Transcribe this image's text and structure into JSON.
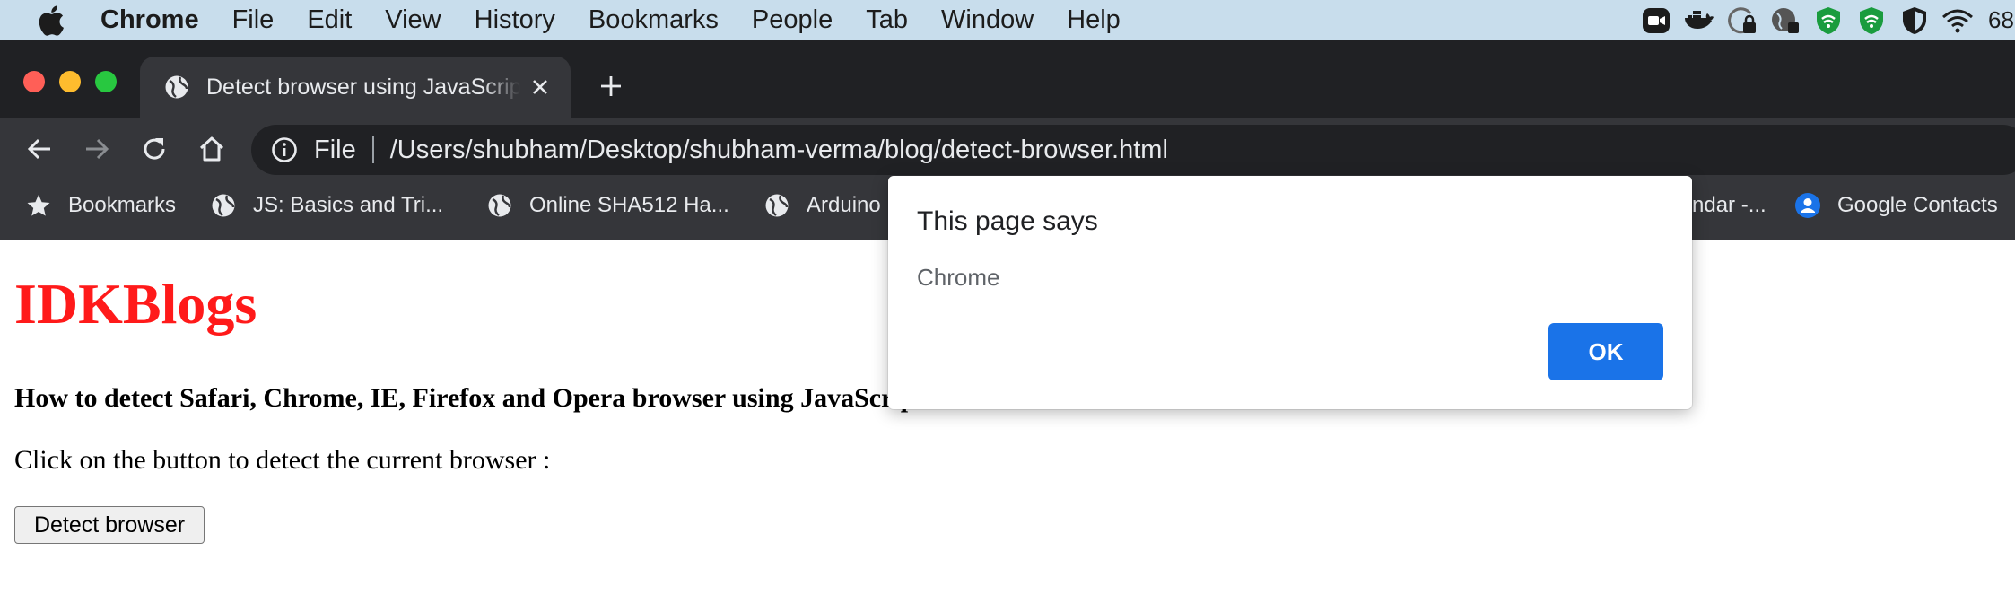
{
  "menubar": {
    "app_name": "Chrome",
    "items": [
      "File",
      "Edit",
      "View",
      "History",
      "Bookmarks",
      "People",
      "Tab",
      "Window",
      "Help"
    ],
    "clock_partial": "68"
  },
  "tab": {
    "title": "Detect browser using JavaScript"
  },
  "omnibox": {
    "scheme_label": "File",
    "url": "/Users/shubham/Desktop/shubham-verma/blog/detect-browser.html"
  },
  "bookmarks": {
    "items": [
      {
        "label": "Bookmarks",
        "icon": "star-icon"
      },
      {
        "label": "JS: Basics and Tri...",
        "icon": "globe-icon"
      },
      {
        "label": "Online SHA512 Ha...",
        "icon": "globe-icon"
      },
      {
        "label": "Arduino",
        "icon": "globe-icon"
      },
      {
        "label": "ndar -...",
        "icon": "none"
      },
      {
        "label": "Google Contacts",
        "icon": "contacts-icon"
      }
    ]
  },
  "page": {
    "heading": "IDKBlogs",
    "subtitle": "How to detect Safari, Chrome, IE, Firefox and Opera browser using JavaScript",
    "instruction": "Click on the button to detect the current browser :",
    "button_label": "Detect browser"
  },
  "dialog": {
    "title": "This page says",
    "message": "Chrome",
    "ok_label": "OK"
  },
  "colors": {
    "heading": "#ff1a1a",
    "ok_button": "#1a73e8",
    "menubar": "#c8ddec",
    "chrome_dark": "#202124",
    "chrome_toolbar": "#35363a"
  }
}
